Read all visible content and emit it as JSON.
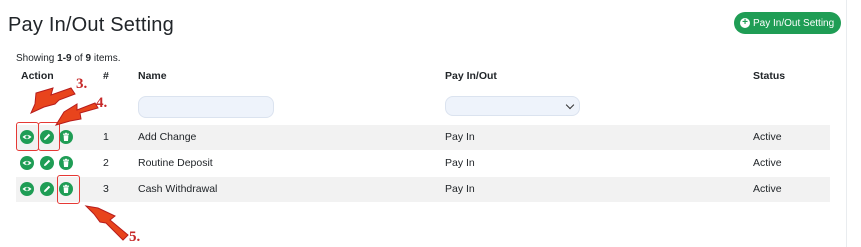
{
  "page": {
    "title": "Pay In/Out Setting"
  },
  "add_button": {
    "label": "Pay In/Out Setting"
  },
  "summary": {
    "prefix": "Showing ",
    "range": "1-9",
    "middle": " of ",
    "total": "9",
    "suffix": " items."
  },
  "table": {
    "headers": {
      "action": "Action",
      "index": "#",
      "name": "Name",
      "pay": "Pay In/Out",
      "status": "Status"
    },
    "rows": [
      {
        "index": "1",
        "name": "Add Change",
        "pay": "Pay In",
        "status": "Active"
      },
      {
        "index": "2",
        "name": "Routine Deposit",
        "pay": "Pay In",
        "status": "Active"
      },
      {
        "index": "3",
        "name": "Cash Withdrawal",
        "pay": "Pay In",
        "status": "Active"
      }
    ]
  },
  "callouts": {
    "c3": "3.",
    "c4": "4.",
    "c5": "5."
  },
  "colors": {
    "accent": "#1f9d55",
    "callout": "#e53935",
    "stripe": "#f2f2f2"
  },
  "icons": {
    "view": "eye-icon",
    "edit": "pencil-icon",
    "delete": "trash-icon",
    "add": "plus-circle-icon"
  }
}
